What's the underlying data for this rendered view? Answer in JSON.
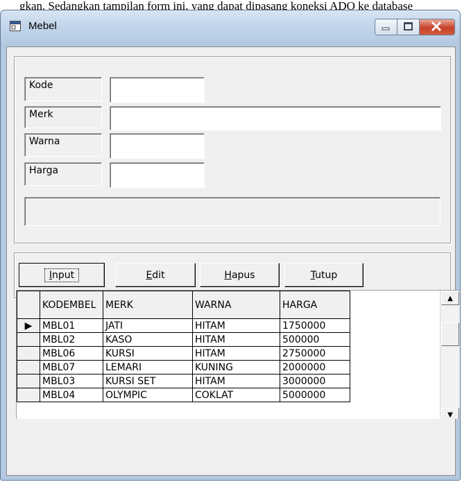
{
  "caption": "gkan. Sedangkan tampilan form ini, yang dapat dipasang koneksi ADO ke database",
  "window": {
    "title": "Mebel",
    "controls": [
      "minimize-icon",
      "maximize-icon",
      "close-icon"
    ]
  },
  "form": {
    "kode_label": "Kode",
    "kode_value": "",
    "merk_label": "Merk",
    "merk_value": "",
    "warna_label": "Warna",
    "warna_value": "",
    "harga_label": "Harga",
    "harga_value": "",
    "status_text": ""
  },
  "buttons": {
    "input": {
      "accel": "I",
      "rest": "nput"
    },
    "edit": {
      "accel": "E",
      "rest": "dit"
    },
    "hapus": {
      "accel": "H",
      "rest": "apus"
    },
    "tutup": {
      "accel": "T",
      "rest": "utup"
    }
  },
  "grid": {
    "columns": [
      "KODEMBEL",
      "MERK",
      "WARNA",
      "HARGA"
    ],
    "current_row_marker": "▶",
    "rows": [
      [
        "MBL01",
        "JATI",
        "HITAM",
        "1750000"
      ],
      [
        "MBL02",
        "KASO",
        "HITAM",
        "500000"
      ],
      [
        "MBL06",
        "KURSI",
        "HITAM",
        "2750000"
      ],
      [
        "MBL07",
        "LEMARI",
        "KUNING",
        "2000000"
      ],
      [
        "MBL03",
        "KURSI SET",
        "HITAM",
        "3000000"
      ],
      [
        "MBL04",
        "OLYMPIC",
        "COKLAT",
        "5000000"
      ]
    ],
    "scroll_up": "▲",
    "scroll_down": "▼"
  }
}
